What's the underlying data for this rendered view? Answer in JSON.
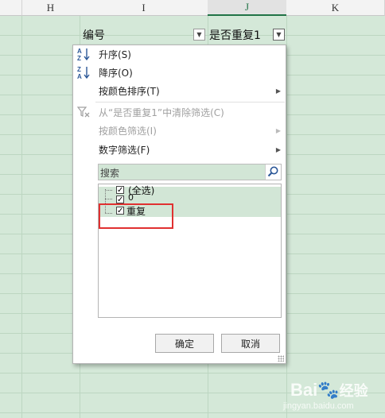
{
  "columns": [
    "H",
    "I",
    "J",
    "K"
  ],
  "header_cells": {
    "id_label": "编号",
    "dup_label": "是否重复1"
  },
  "menu": {
    "sort_asc": "升序(S)",
    "sort_desc": "降序(O)",
    "sort_by_color": "按颜色排序(T)",
    "clear_filter": "从“是否重复1”中清除筛选(C)",
    "filter_by_color": "按颜色筛选(I)",
    "number_filter": "数字筛选(F)"
  },
  "search": {
    "placeholder": "搜索"
  },
  "list": [
    {
      "label": "(全选)",
      "checked": true
    },
    {
      "label": "0",
      "checked": true
    },
    {
      "label": "重复",
      "checked": true
    }
  ],
  "buttons": {
    "ok": "确定",
    "cancel": "取消"
  },
  "icons": {
    "sort_asc": "AZ",
    "sort_desc": "ZA"
  },
  "colors": {
    "sheet_bg": "#d4e8d8",
    "highlight": "#d2e6d6",
    "annotation": "#e03131"
  },
  "watermark": {
    "brand": "Bai",
    "brand2": "经验",
    "url": "jingyan.baidu.com"
  }
}
